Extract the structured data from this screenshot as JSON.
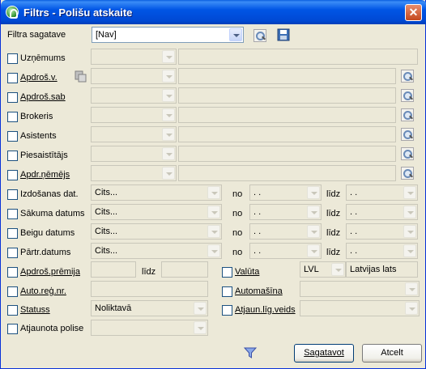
{
  "window": {
    "title": "Filtrs - Polišu atskaite",
    "close_label": "✕"
  },
  "filter_preset": {
    "label": "Filtra sagatave",
    "value": "[Nav]"
  },
  "rows": {
    "uznemums": "Uzņēmums",
    "apdros_v": "Apdroš.v.",
    "apdros_sab": "Apdroš.sab",
    "brokeris": "Brokeris",
    "asistents": "Asistents",
    "piesaistitajs": "Piesaistītājs",
    "apdr_nemejs": "Apdr.ņēmējs"
  },
  "date_rows": {
    "izdosanas": {
      "label": "Izdošanas dat.",
      "value": "Cits..."
    },
    "sakuma": {
      "label": "Sākuma datums",
      "value": "Cits..."
    },
    "beigu": {
      "label": "Beigu datums",
      "value": "Cits..."
    },
    "partr": {
      "label": "Pārtr.datums",
      "value": "Cits..."
    },
    "no": "no",
    "lidz": "līdz",
    "date_placeholder": " .  ."
  },
  "premium": {
    "label": "Apdroš.prēmija",
    "lidz": "līdz"
  },
  "currency": {
    "label": "Valūta",
    "code": "LVL",
    "name": "Latvijas lats"
  },
  "auto_reg": {
    "label": "Auto.reģ.nr."
  },
  "automasina": {
    "label": "Automašīna"
  },
  "status": {
    "label": "Statuss",
    "value": "Noliktavā"
  },
  "atjaun_lig": {
    "label": "Atjaun.līg.veids"
  },
  "atjaunota": {
    "label": "Atjaunota polise"
  },
  "buttons": {
    "sagatavot": "Sagatavot",
    "atcelt": "Atcelt"
  }
}
